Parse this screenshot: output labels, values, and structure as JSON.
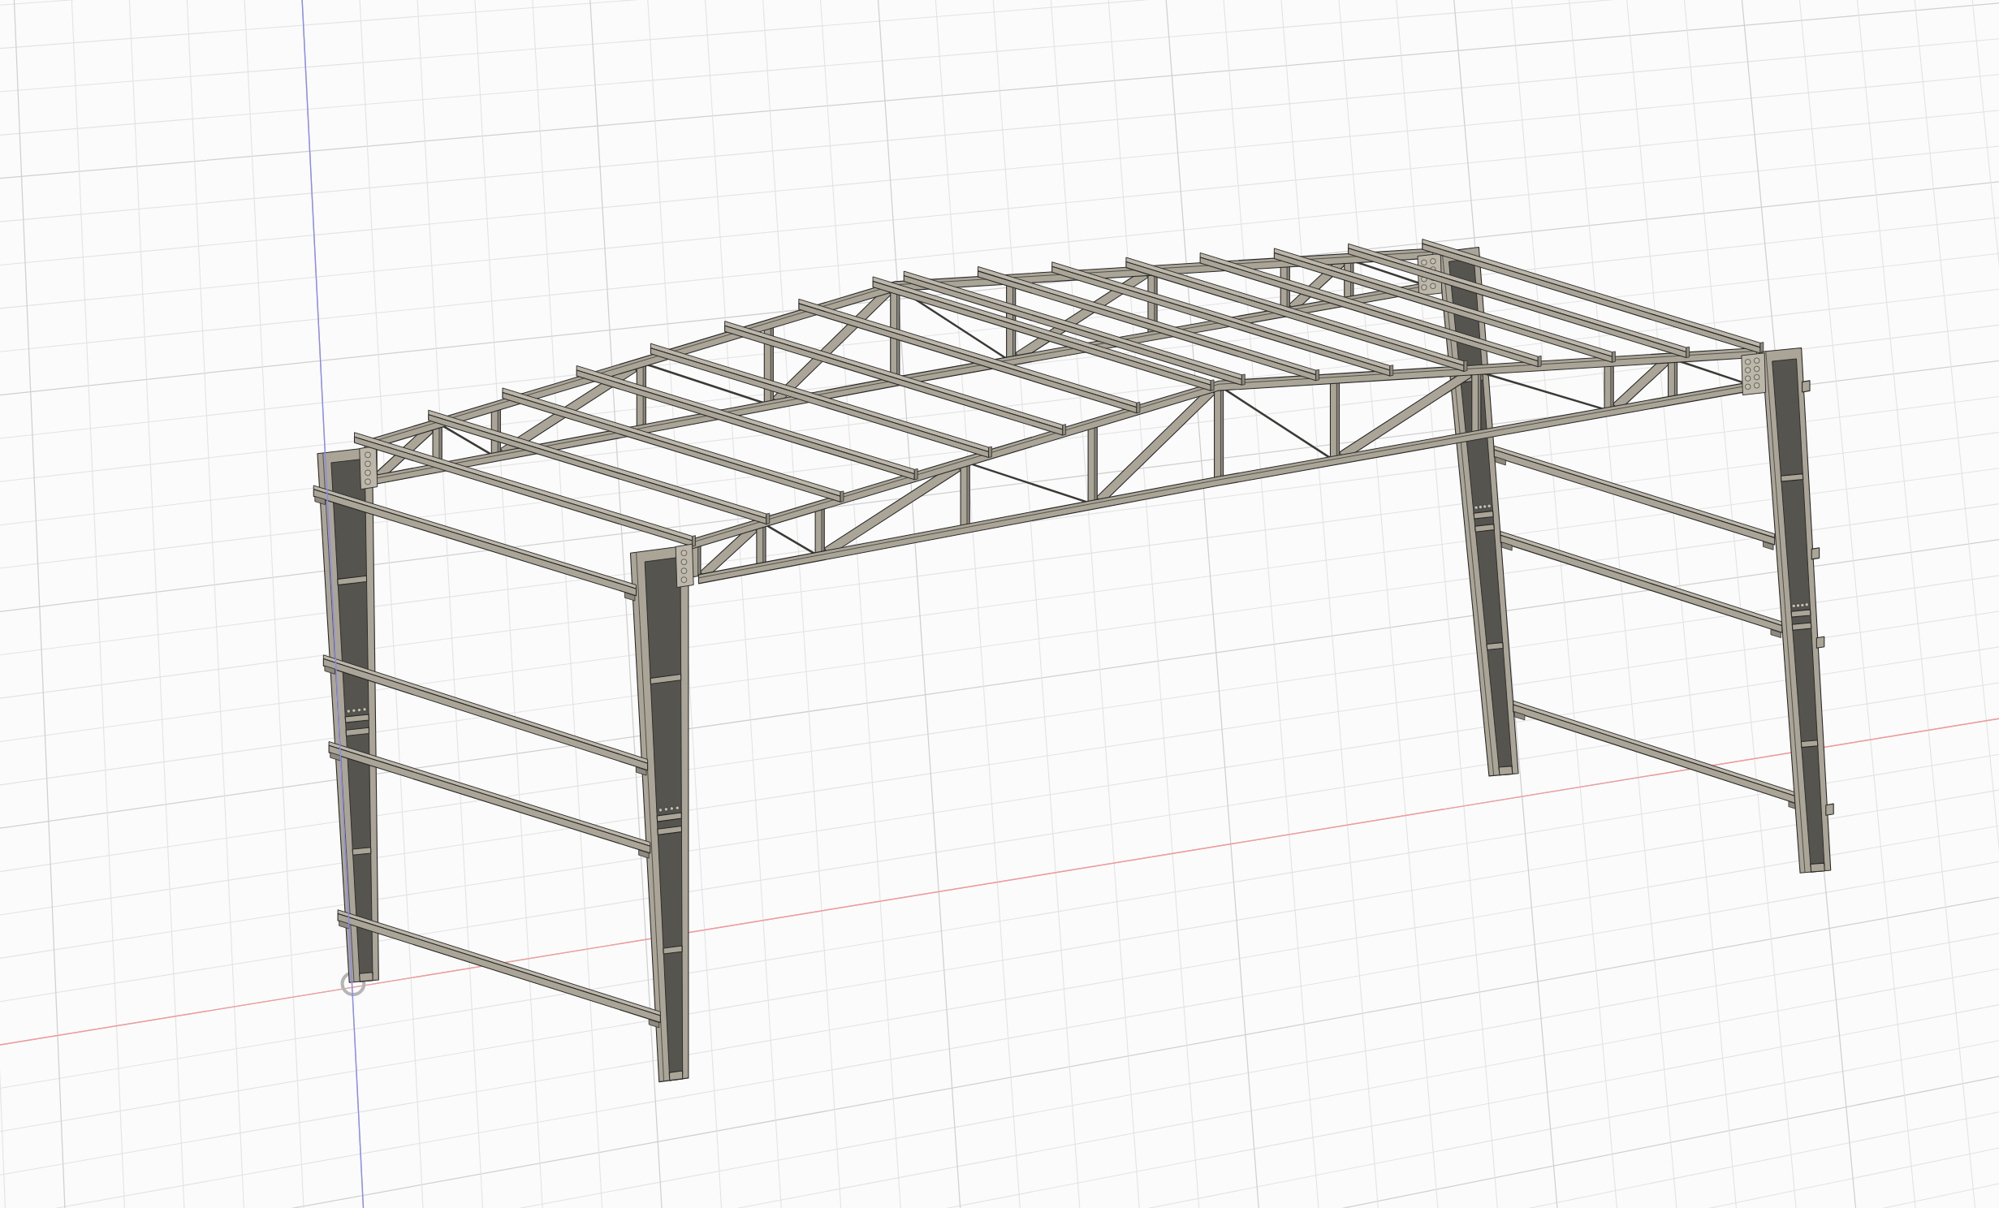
{
  "viewport": {
    "grid": true,
    "axes": true,
    "origin_marker": true
  },
  "model": {
    "kind": "steel-frame"
  }
}
